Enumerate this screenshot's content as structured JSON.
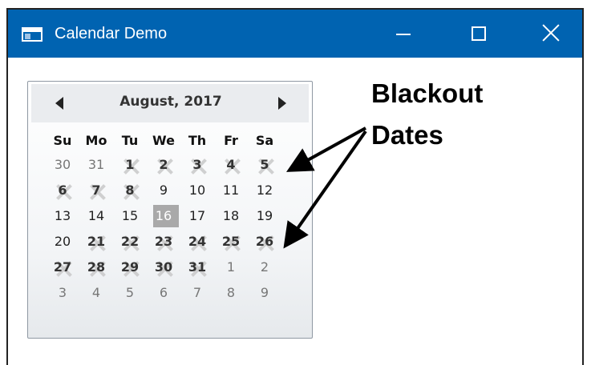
{
  "window": {
    "title": "Calendar Demo",
    "controls": {
      "minimize": "minimize",
      "maximize": "maximize",
      "close": "close"
    }
  },
  "calendar": {
    "month_label": "August, 2017",
    "weekdays": [
      "Su",
      "Mo",
      "Tu",
      "We",
      "Th",
      "Fr",
      "Sa"
    ],
    "weeks": [
      [
        {
          "d": "30",
          "o": true
        },
        {
          "d": "31",
          "o": true
        },
        {
          "d": "1",
          "b": true
        },
        {
          "d": "2",
          "b": true
        },
        {
          "d": "3",
          "b": true
        },
        {
          "d": "4",
          "b": true
        },
        {
          "d": "5",
          "b": true
        }
      ],
      [
        {
          "d": "6",
          "b": true
        },
        {
          "d": "7",
          "b": true
        },
        {
          "d": "8",
          "b": true
        },
        {
          "d": "9"
        },
        {
          "d": "10"
        },
        {
          "d": "11"
        },
        {
          "d": "12"
        }
      ],
      [
        {
          "d": "13"
        },
        {
          "d": "14"
        },
        {
          "d": "15"
        },
        {
          "d": "16",
          "t": true
        },
        {
          "d": "17"
        },
        {
          "d": "18"
        },
        {
          "d": "19"
        }
      ],
      [
        {
          "d": "20"
        },
        {
          "d": "21",
          "b": true
        },
        {
          "d": "22",
          "b": true
        },
        {
          "d": "23",
          "b": true
        },
        {
          "d": "24",
          "b": true
        },
        {
          "d": "25",
          "b": true
        },
        {
          "d": "26",
          "b": true
        }
      ],
      [
        {
          "d": "27",
          "b": true
        },
        {
          "d": "28",
          "b": true
        },
        {
          "d": "29",
          "b": true
        },
        {
          "d": "30",
          "b": true
        },
        {
          "d": "31",
          "b": true
        },
        {
          "d": "1",
          "o": true
        },
        {
          "d": "2",
          "o": true
        }
      ],
      [
        {
          "d": "3",
          "o": true
        },
        {
          "d": "4",
          "o": true
        },
        {
          "d": "5",
          "o": true
        },
        {
          "d": "6",
          "o": true
        },
        {
          "d": "7",
          "o": true
        },
        {
          "d": "8",
          "o": true
        },
        {
          "d": "9",
          "o": true
        }
      ]
    ]
  },
  "annotation": {
    "line1": "Blackout",
    "line2": "Dates"
  },
  "colors": {
    "titlebar": "#0063b1",
    "today_highlight": "#a9a9a9",
    "blackout_x": "#c8c8c8"
  }
}
